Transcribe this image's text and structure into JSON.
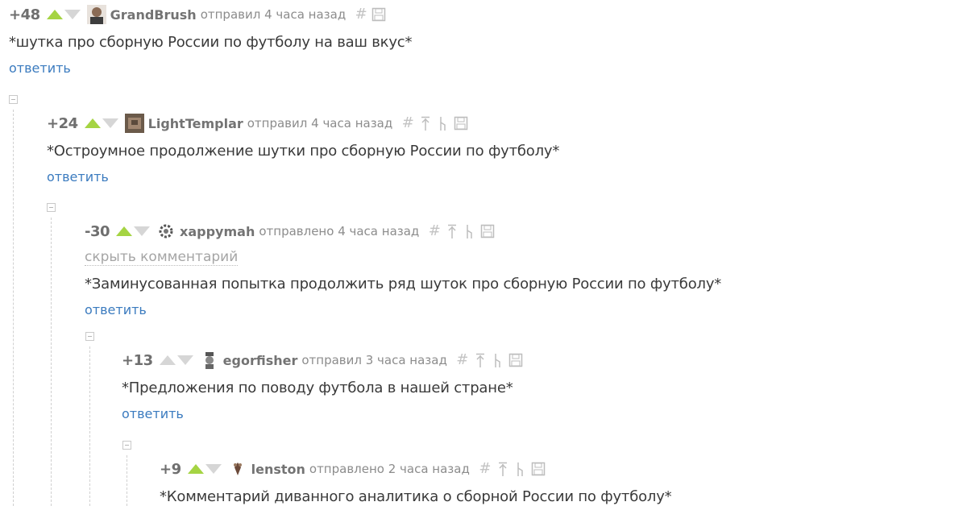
{
  "comments": [
    {
      "rating": "+48",
      "username": "GrandBrush",
      "meta": "отправил 4 часа назад",
      "text": "*шутка про сборную России по футболу на ваш вкус*",
      "reply": "ответить",
      "up_active": true
    },
    {
      "rating": "+24",
      "username": "LightTemplar",
      "meta": "отправил 4 часа назад",
      "text": "*Остроумное продолжение шутки про сборную России по футболу*",
      "reply": "ответить",
      "up_active": true
    },
    {
      "rating": "-30",
      "username": "xappymah",
      "meta": "отправлено 4 часа назад",
      "hide": "скрыть комментарий",
      "text": "*Заминусованная попытка продолжить ряд шуток про сборную России по футболу*",
      "reply": "ответить",
      "up_active": true
    },
    {
      "rating": "+13",
      "username": "egorfisher",
      "meta": "отправил 3 часа назад",
      "text": "*Предложения по поводу футбола в нашей стране*",
      "reply": "ответить",
      "up_active": false
    },
    {
      "rating": "+9",
      "username": "lenston",
      "meta": "отправлено 2 часа назад",
      "text": "*Комментарий диванного аналитика о сборной России по футболу*",
      "up_active": true
    }
  ],
  "icons": {
    "vote_up": "triangle-up-icon",
    "vote_down": "triangle-down-icon",
    "link": "hash-icon",
    "parent": "arrow-up-icon",
    "branch": "branch-icon",
    "save": "floppy-disk-icon",
    "collapse": "minus-square-icon"
  },
  "colors": {
    "vote_up": "#a5d443",
    "vote_neutral": "#d6d6d6",
    "reply_link": "#3b7bbf",
    "username": "#737373",
    "meta": "#8c8c8c"
  }
}
